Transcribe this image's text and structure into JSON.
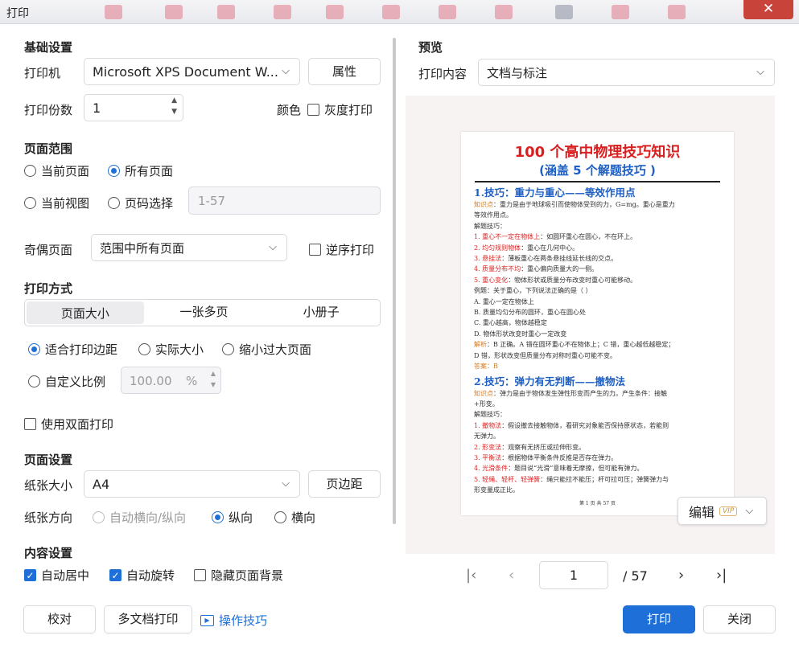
{
  "window": {
    "title": "打印",
    "close_glyph": "✕"
  },
  "basic": {
    "section": "基础设置",
    "printer_label": "打印机",
    "printer_value": "Microsoft XPS Document W...",
    "properties_btn": "属性",
    "copies_label": "打印份数",
    "copies_value": "1",
    "color_label": "颜色",
    "gray_label": "灰度打印"
  },
  "range": {
    "section": "页面范围",
    "current_page": "当前页面",
    "all_pages": "所有页面",
    "current_view": "当前视图",
    "page_select": "页码选择",
    "page_range_placeholder": "1-57",
    "odd_even_label": "奇偶页面",
    "odd_even_value": "范围中所有页面",
    "reverse_label": "逆序打印"
  },
  "mode": {
    "section": "打印方式",
    "tabs": [
      "页面大小",
      "一张多页",
      "小册子"
    ],
    "fit_margin": "适合打印边距",
    "actual_size": "实际大小",
    "shrink_large": "缩小过大页面",
    "custom_scale": "自定义比例",
    "scale_value": "100.00",
    "scale_unit": "%",
    "duplex": "使用双面打印"
  },
  "page_setup": {
    "section": "页面设置",
    "paper_label": "纸张大小",
    "paper_value": "A4",
    "margin_btn": "页边距",
    "orient_label": "纸张方向",
    "orient_auto": "自动横向/纵向",
    "orient_portrait": "纵向",
    "orient_landscape": "横向"
  },
  "content": {
    "section": "内容设置",
    "auto_center": "自动居中",
    "auto_rotate": "自动旋转",
    "hide_bg": "隐藏页面背景"
  },
  "footer": {
    "proof_btn": "校对",
    "multi_btn": "多文档打印",
    "tips_link": "操作技巧",
    "print_btn": "打印",
    "close_btn": "关闭"
  },
  "preview": {
    "section": "预览",
    "content_label": "打印内容",
    "content_value": "文档与标注",
    "edit_btn": "编辑",
    "vip": "VIP",
    "current_page": "1",
    "total_pages": "/ 57"
  },
  "doc": {
    "title": "100 个高中物理技巧知识",
    "subtitle": "(涵盖 5 个解题技巧 )",
    "h1": "1.技巧：重力与重心——等效作用点",
    "l1a": "知识点",
    "l1b": "：重力是由于地球吸引而使物体受到的力，G=mg。重心是重力",
    "l2": "等效作用点。",
    "l3": "解题技巧：",
    "l4a": "1. 重心不一定在物体上",
    "l4b": "：如圆环重心在圆心，不在环上。",
    "l5a": "2. 均匀规则物体",
    "l5b": "：重心在几何中心。",
    "l6a": "3. 悬挂法",
    "l6b": "：薄板重心在两条悬挂线延长线的交点。",
    "l7a": "4. 质量分布不均",
    "l7b": "：重心偏向质量大的一侧。",
    "l8a": "5. 重心变化",
    "l8b": "：物体形状或质量分布改变时重心可能移动。",
    "l9": "例题：关于重心，下列说法正确的是（ ）",
    "l10": "A. 重心一定在物体上",
    "l11": "B. 质量均匀分布的圆环，重心在圆心处",
    "l12": "C. 重心越高，物体越稳定",
    "l13": "D. 物体形状改变时重心一定改变",
    "l14a": "解析",
    "l14b": "：B 正确。A 错在圆环重心不在物体上；C 错，重心越低越稳定；",
    "l15": "D 错，形状改变但质量分布对称时重心可能不变。",
    "l16": "答案：B",
    "h2": "2.技巧：弹力有无判断——撤物法",
    "l17a": "知识点",
    "l17b": "：弹力是由于物体发生弹性形变而产生的力。产生条件：接触",
    "l18": "+形变。",
    "l19": "解题技巧：",
    "l20a": "1. 撤物法",
    "l20b": "：假设撤去接触物体，看研究对象能否保持原状态，若能则",
    "l21": "无弹力。",
    "l22a": "2. 形变法",
    "l22b": "：观察有无挤压或拉伸形变。",
    "l23a": "3. 平衡法",
    "l23b": "：根据物体平衡条件反推是否存在弹力。",
    "l24a": "4. 光滑条件",
    "l24b": "：题目说“光滑”意味着无摩擦，但可能有弹力。",
    "l25a": "5. 轻绳、轻杆、轻弹簧",
    "l25b": "：绳只能拉不能压；杆可拉可压；弹簧弹力与",
    "l26": "形变量成正比。",
    "foot": "第 1 页 共 57 页"
  },
  "colors": {
    "accent": "#1f6fd8",
    "title_red": "#d91f1f",
    "close_red": "#c8443a"
  }
}
